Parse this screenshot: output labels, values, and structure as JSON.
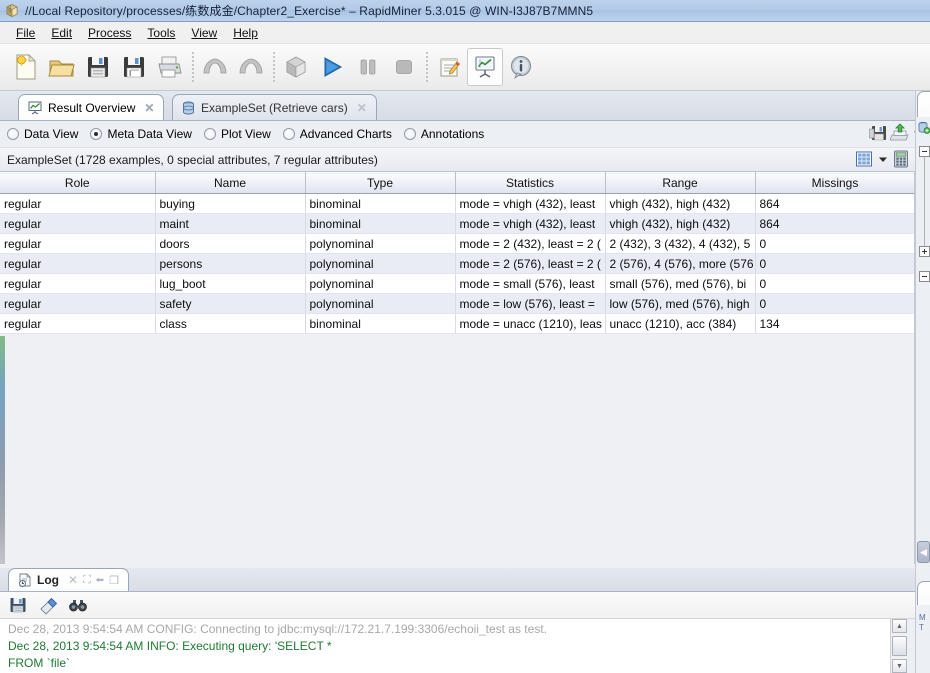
{
  "window": {
    "title": "//Local Repository/processes/练数成金/Chapter2_Exercise* – RapidMiner 5.3.015 @ WIN-I3J87B7MMN5",
    "icon": "rapidminer-cube-icon"
  },
  "menubar": {
    "items": [
      {
        "label": "File",
        "mnemonic": "F"
      },
      {
        "label": "Edit",
        "mnemonic": "E"
      },
      {
        "label": "Process",
        "mnemonic": "P"
      },
      {
        "label": "Tools",
        "mnemonic": "T"
      },
      {
        "label": "View",
        "mnemonic": "V"
      },
      {
        "label": "Help",
        "mnemonic": "H"
      }
    ]
  },
  "toolbar": {
    "buttons": [
      {
        "name": "new-process-button",
        "icon": "new-document-icon"
      },
      {
        "name": "open-process-button",
        "icon": "open-folder-icon"
      },
      {
        "name": "save-process-button",
        "icon": "floppy-save-icon"
      },
      {
        "name": "save-as-button",
        "icon": "floppy-save-as-icon"
      },
      {
        "name": "print-button",
        "icon": "printer-icon"
      },
      {
        "name": "undo-button",
        "icon": "undo-arrow-icon"
      },
      {
        "name": "redo-button",
        "icon": "redo-arrow-icon"
      },
      {
        "name": "process-cube-button",
        "icon": "cube-icon"
      },
      {
        "name": "run-button",
        "icon": "play-triangle-icon"
      },
      {
        "name": "pause-button",
        "icon": "pause-bars-icon"
      },
      {
        "name": "stop-button",
        "icon": "stop-square-icon"
      },
      {
        "name": "design-perspective-button",
        "icon": "design-notepad-icon"
      },
      {
        "name": "result-perspective-button",
        "icon": "result-chart-easel-icon"
      },
      {
        "name": "info-button",
        "icon": "info-bubble-icon"
      }
    ]
  },
  "tabs": [
    {
      "label": "Result Overview",
      "icon": "result-chart-icon",
      "active": true,
      "close": "✕"
    },
    {
      "label": "ExampleSet (Retrieve cars)",
      "icon": "database-icon",
      "active": false,
      "close": "✕"
    }
  ],
  "view_options": {
    "items": [
      {
        "label": "Data View",
        "selected": false
      },
      {
        "label": "Meta Data View",
        "selected": true
      },
      {
        "label": "Plot View",
        "selected": false
      },
      {
        "label": "Advanced Charts",
        "selected": false
      },
      {
        "label": "Annotations",
        "selected": false
      }
    ],
    "actions": [
      {
        "name": "save-view-button",
        "icon": "floppy-save-icon"
      },
      {
        "name": "export-view-button",
        "icon": "export-green-arrow-icon"
      },
      {
        "name": "view-options-dropdown",
        "icon": "chevron-down-icon"
      }
    ]
  },
  "exampleset": {
    "summary": "ExampleSet (1728 examples, 0 special attributes, 7 regular attributes)",
    "actions": [
      {
        "name": "table-grid-button",
        "icon": "grid-table-icon"
      },
      {
        "name": "table-grid-dropdown",
        "icon": "chevron-down-icon"
      },
      {
        "name": "calculator-button",
        "icon": "calculator-icon"
      }
    ]
  },
  "table": {
    "columns": [
      "Role",
      "Name",
      "Type",
      "Statistics",
      "Range",
      "Missings"
    ],
    "rows": [
      [
        "regular",
        "buying",
        "binominal",
        "mode = vhigh (432), least ",
        "vhigh (432), high (432)",
        "864"
      ],
      [
        "regular",
        "maint",
        "binominal",
        "mode = vhigh (432), least ",
        "vhigh (432), high (432)",
        "864"
      ],
      [
        "regular",
        "doors",
        "polynominal",
        "mode = 2 (432), least = 2 (",
        "2 (432), 3 (432), 4 (432), 5",
        "0"
      ],
      [
        "regular",
        "persons",
        "polynominal",
        "mode = 2 (576), least = 2 (",
        "2 (576), 4 (576), more (576",
        "0"
      ],
      [
        "regular",
        "lug_boot",
        "polynominal",
        "mode = small (576), least ",
        "small (576), med (576), bi",
        "0"
      ],
      [
        "regular",
        "safety",
        "polynominal",
        "mode = low (576), least = ",
        "low (576), med (576), high",
        "0"
      ],
      [
        "regular",
        "class",
        "binominal",
        "mode = unacc (1210), leas",
        "unacc (1210), acc (384)",
        "134"
      ]
    ]
  },
  "log": {
    "tab_label": "Log",
    "tab_icon": "log-document-icon",
    "tab_actions": [
      {
        "name": "log-close-icon",
        "glyph": "✕"
      },
      {
        "name": "log-maximize-icon",
        "glyph": "⛶"
      },
      {
        "name": "log-dock-icon",
        "glyph": "⬅"
      },
      {
        "name": "log-detach-icon",
        "glyph": "❐"
      }
    ],
    "toolbar": [
      {
        "name": "log-save-button",
        "icon": "floppy-save-icon"
      },
      {
        "name": "log-clear-button",
        "icon": "eraser-icon"
      },
      {
        "name": "log-search-button",
        "icon": "binoculars-icon"
      }
    ],
    "lines": [
      {
        "text": "Dec 28, 2013 9:54:54 AM CONFIG: Connecting to jdbc:mysql://172.21.7.199:3306/echoii_test as test.",
        "level": "config"
      },
      {
        "text": "Dec 28, 2013 9:54:54 AM INFO: Executing query: 'SELECT *",
        "level": "info"
      },
      {
        "text": "FROM `file`",
        "level": "info"
      }
    ]
  },
  "right_panel": {
    "collapse_label": "◀",
    "icon": "database-add-icon"
  },
  "colors": {
    "titlebar": "#b3cbe8",
    "accent_green": "#1f7a33",
    "table_alt_row": "#e9ecf5",
    "panel_bg": "#eceff3"
  }
}
